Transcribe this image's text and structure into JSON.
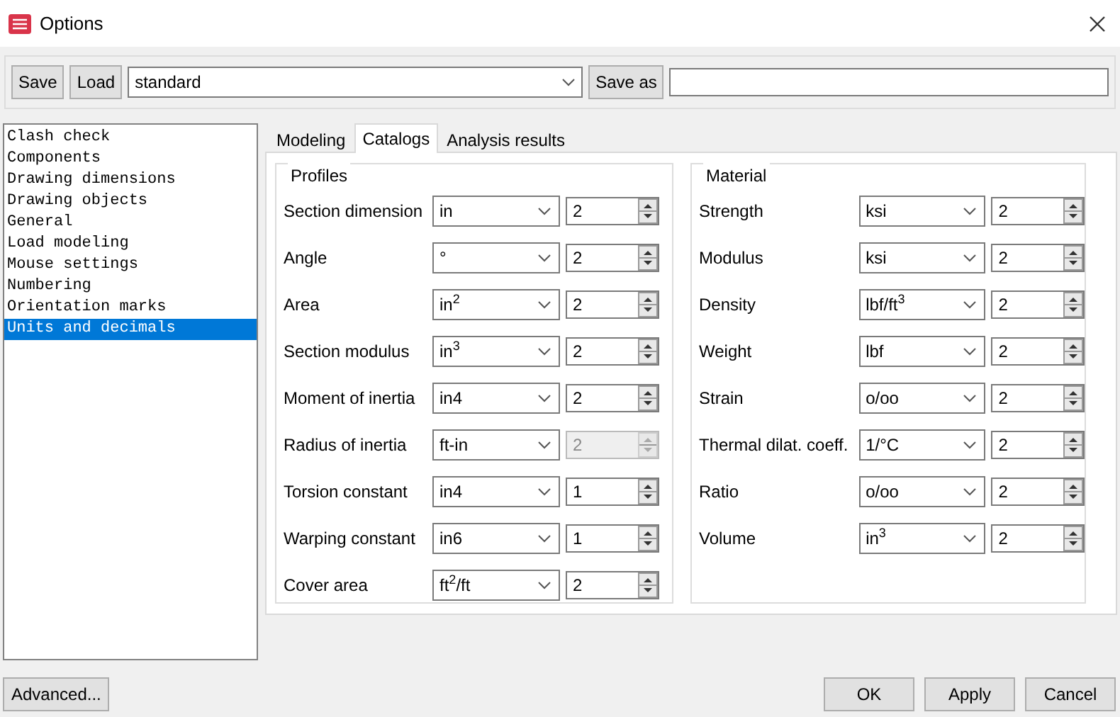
{
  "window": {
    "title": "Options"
  },
  "toolbar": {
    "save": "Save",
    "load": "Load",
    "preset": "standard",
    "save_as": "Save as"
  },
  "sidebar": {
    "items": [
      {
        "label": "Clash check",
        "selected": false
      },
      {
        "label": "Components",
        "selected": false
      },
      {
        "label": "Drawing dimensions",
        "selected": false
      },
      {
        "label": "Drawing objects",
        "selected": false
      },
      {
        "label": "General",
        "selected": false
      },
      {
        "label": "Load modeling",
        "selected": false
      },
      {
        "label": "Mouse settings",
        "selected": false
      },
      {
        "label": "Numbering",
        "selected": false
      },
      {
        "label": "Orientation marks",
        "selected": false
      },
      {
        "label": "Units and decimals",
        "selected": true
      }
    ]
  },
  "tabs": [
    {
      "label": "Modeling",
      "selected": false
    },
    {
      "label": "Catalogs",
      "selected": true
    },
    {
      "label": "Analysis results",
      "selected": false
    }
  ],
  "groups": [
    {
      "title": "Profiles",
      "rows": [
        {
          "label": "Section dimension",
          "unit": "in",
          "decimals": "2",
          "disabled": false
        },
        {
          "label": "Angle",
          "unit": "°",
          "decimals": "2",
          "disabled": false
        },
        {
          "label": "Area",
          "unit": "in$^{2}$",
          "decimals": "2",
          "disabled": false
        },
        {
          "label": "Section modulus",
          "unit": "in$^{3}$",
          "decimals": "2",
          "disabled": false
        },
        {
          "label": "Moment of inertia",
          "unit": "in4",
          "decimals": "2",
          "disabled": false
        },
        {
          "label": "Radius of inertia",
          "unit": "ft-in",
          "decimals": "2",
          "disabled": true
        },
        {
          "label": "Torsion constant",
          "unit": "in4",
          "decimals": "1",
          "disabled": false
        },
        {
          "label": "Warping constant",
          "unit": "in6",
          "decimals": "1",
          "disabled": false
        },
        {
          "label": "Cover area",
          "unit": "ft$^{2}$/ft",
          "decimals": "2",
          "disabled": false
        }
      ]
    },
    {
      "title": "Material",
      "rows": [
        {
          "label": "Strength",
          "unit": "ksi",
          "decimals": "2",
          "disabled": false
        },
        {
          "label": "Modulus",
          "unit": "ksi",
          "decimals": "2",
          "disabled": false
        },
        {
          "label": "Density",
          "unit": "lbf/ft$^{3}$",
          "decimals": "2",
          "disabled": false
        },
        {
          "label": "Weight",
          "unit": "lbf",
          "decimals": "2",
          "disabled": false
        },
        {
          "label": "Strain",
          "unit": "o/oo",
          "decimals": "2",
          "disabled": false
        },
        {
          "label": "Thermal dilat. coeff.",
          "unit": "1/°C",
          "decimals": "2",
          "disabled": false
        },
        {
          "label": "Ratio",
          "unit": "o/oo",
          "decimals": "2",
          "disabled": false
        },
        {
          "label": "Volume",
          "unit": "in$^{3}$",
          "decimals": "2",
          "disabled": false
        }
      ]
    }
  ],
  "footer": {
    "advanced": "Advanced...",
    "ok": "OK",
    "apply": "Apply",
    "cancel": "Cancel"
  }
}
